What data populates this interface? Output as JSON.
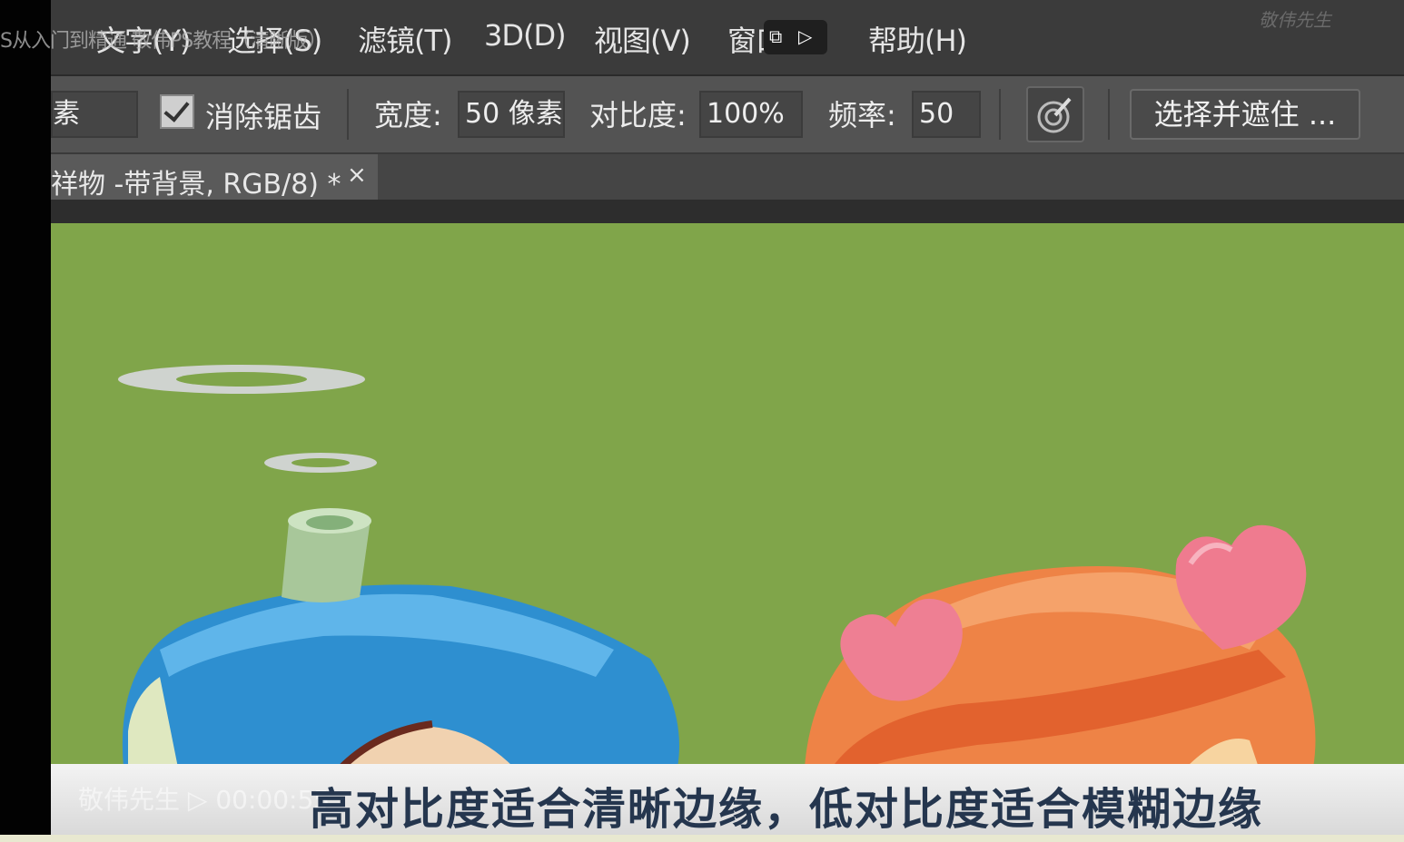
{
  "video": {
    "title_overlay": "S从入门到精通 敬伟PS教程（清晰版）",
    "watermark": "敬伟先生"
  },
  "menubar": {
    "items": [
      "文字(Y)",
      "选择(S)",
      "滤镜(T)",
      "3D(D)",
      "视图(V)",
      "窗口",
      "帮助(H)"
    ]
  },
  "options": {
    "mode_value": "素",
    "antialias_label": "消除锯齿",
    "antialias_checked": true,
    "width_label": "宽度:",
    "width_value": "50 像素",
    "contrast_label": "对比度:",
    "contrast_value": "100%",
    "frequency_label": "频率:",
    "frequency_value": "50",
    "select_mask_label": "选择并遮住 ..."
  },
  "document_tab": {
    "title": "祥物 -带背景, RGB/8) *",
    "close": "×"
  },
  "canvas": {
    "background_color": "#80a54a"
  },
  "player": {
    "left_text": "敬伟先生 ▷ 00:00:55",
    "subtitle": "高对比度适合清晰边缘，低对比度适合模糊边缘"
  },
  "icons": [
    "restore-icon",
    "cast-icon",
    "pen-pressure-icon",
    "checkbox-icon",
    "close-icon"
  ]
}
